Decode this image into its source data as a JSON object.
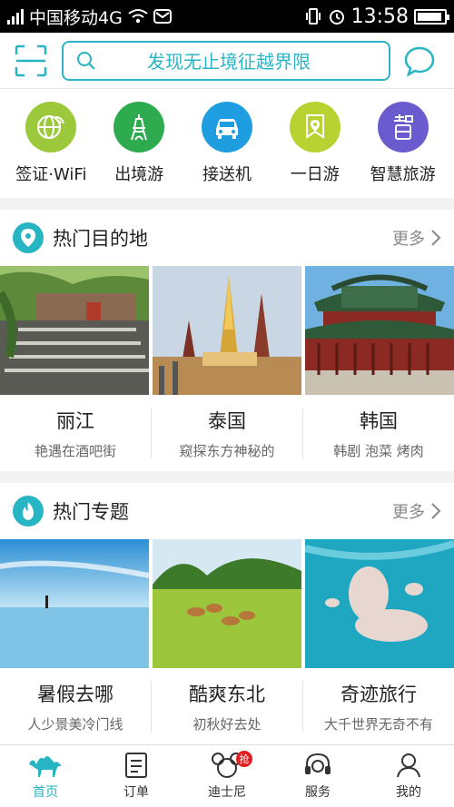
{
  "status": {
    "carrier": "中国移动4G",
    "time": "13:58"
  },
  "topbar": {
    "search_placeholder": "发现无止境征越界限"
  },
  "quick": [
    {
      "label": "签证·WiFi",
      "color": "#9cc93b",
      "icon": "globe-wifi-icon"
    },
    {
      "label": "出境游",
      "color": "#2eaa4f",
      "icon": "eiffel-tower-icon"
    },
    {
      "label": "接送机",
      "color": "#1e9ee0",
      "icon": "car-icon"
    },
    {
      "label": "一日游",
      "color": "#b8d232",
      "icon": "map-pin-flag-icon"
    },
    {
      "label": "智慧旅游",
      "color": "#6a5ccf",
      "icon": "smart-tour-icon"
    }
  ],
  "destinations": {
    "title": "热门目的地",
    "more": "更多",
    "items": [
      {
        "title": "丽江",
        "subtitle": "艳遇在酒吧街"
      },
      {
        "title": "泰国",
        "subtitle": "窥探东方神秘的"
      },
      {
        "title": "韩国",
        "subtitle": "韩剧 泡菜 烤肉"
      }
    ]
  },
  "topics": {
    "title": "热门专题",
    "more": "更多",
    "items": [
      {
        "title": "暑假去哪",
        "subtitle": "人少景美冷门线"
      },
      {
        "title": "酷爽东北",
        "subtitle": "初秋好去处"
      },
      {
        "title": "奇迹旅行",
        "subtitle": "大千世界无奇不有"
      }
    ]
  },
  "tabs": [
    {
      "label": "首页",
      "icon": "camel-icon",
      "active": true
    },
    {
      "label": "订单",
      "icon": "order-list-icon",
      "active": false
    },
    {
      "label": "迪士尼",
      "icon": "mickey-icon",
      "active": false,
      "badge": "抢"
    },
    {
      "label": "服务",
      "icon": "headset-icon",
      "active": false
    },
    {
      "label": "我的",
      "icon": "profile-icon",
      "active": false
    }
  ]
}
